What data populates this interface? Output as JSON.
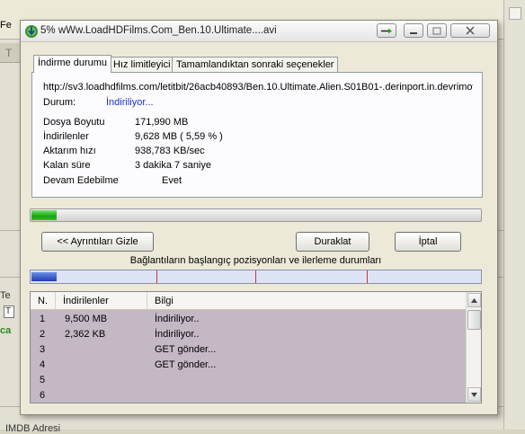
{
  "background": {
    "title_fragment": "Fe",
    "strip_char": "T",
    "left_text_1": "Te",
    "left_text_2": "T",
    "green_text": "ca",
    "bottom_text": "IMDB Adresi"
  },
  "window": {
    "title": "5% wWw.LoadHDFilms.Com_Ben.10.Ultimate....avi",
    "icon": "idm-download-icon",
    "controls": [
      "arrow-icon",
      "minimize-icon",
      "maximize-icon",
      "close-icon"
    ]
  },
  "tabs": [
    {
      "label": "İndirme durumu",
      "active": true
    },
    {
      "label": "Hız limitleyici",
      "active": false
    },
    {
      "label": "Tamamlandıktan sonraki seçenekler",
      "active": false
    }
  ],
  "status": {
    "url": "http://sv3.loadhdfilms.com/letitbit/26acb40893/Ben.10.Ultimate.Alien.S01B01-.derinport.in.devrimow",
    "state_label": "Durum:",
    "state_value": "İndiriliyor...",
    "file_size_label": "Dosya Boyutu",
    "file_size_value": "171,990  MB",
    "downloaded_label": "İndirilenler",
    "downloaded_value": "9,628  MB  ( 5,59 % )",
    "rate_label": "Aktarım hızı",
    "rate_value": "938,783  KB/sec",
    "remaining_label": "Kalan süre",
    "remaining_value": "3 dakika 7 saniye",
    "resume_label": "Devam Edebilme",
    "resume_value": "Evet"
  },
  "progress": {
    "percent": 5.59
  },
  "buttons": {
    "details": "<< Ayrıntıları Gizle",
    "pause": "Duraklat",
    "cancel": "İptal"
  },
  "connections_title": "Bağlantıların başlangıç pozisyonları ve ilerleme durumları",
  "segments": {
    "filled_fraction": 0.056,
    "markers": [
      0.28,
      0.5,
      0.75
    ]
  },
  "list": {
    "columns": [
      "N.",
      "İndirilenler",
      "Bilgi"
    ],
    "rows": [
      {
        "n": "1",
        "downloaded": "9,500  MB",
        "info": "İndiriliyor.."
      },
      {
        "n": "2",
        "downloaded": "2,362  KB",
        "info": "İndiriliyor.."
      },
      {
        "n": "3",
        "downloaded": "",
        "info": "GET gönder..."
      },
      {
        "n": "4",
        "downloaded": "",
        "info": "GET gönder..."
      },
      {
        "n": "5",
        "downloaded": "",
        "info": ""
      },
      {
        "n": "6",
        "downloaded": "",
        "info": ""
      }
    ]
  },
  "colors": {
    "progress_green": "#1aa31a",
    "segment_blue": "#1f3fae",
    "segment_marker": "#c43a3a",
    "list_background": "#c4b8c4",
    "status_blue": "#1a2fcf"
  }
}
